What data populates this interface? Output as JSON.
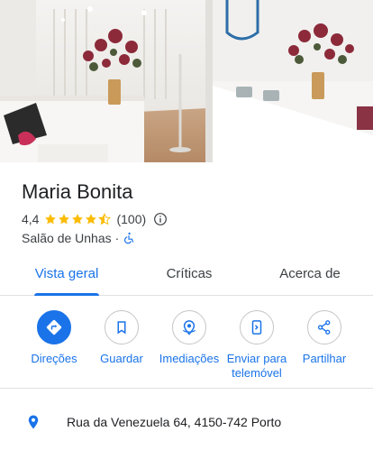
{
  "place": {
    "name": "Maria Bonita",
    "rating": "4,4",
    "stars": 4.4,
    "review_count": "(100)",
    "category": "Salão de Unhas",
    "separator": "·"
  },
  "tabs": [
    {
      "label": "Vista geral",
      "active": true
    },
    {
      "label": "Críticas",
      "active": false
    },
    {
      "label": "Acerca de",
      "active": false
    }
  ],
  "actions": [
    {
      "label": "Direções",
      "icon": "directions-icon"
    },
    {
      "label": "Guardar",
      "icon": "bookmark-icon"
    },
    {
      "label": "Imediações",
      "icon": "nearby-icon"
    },
    {
      "label": "Enviar para telemóvel",
      "icon": "send-to-phone-icon"
    },
    {
      "label": "Partilhar",
      "icon": "share-icon"
    }
  ],
  "address": "Rua da Venezuela 64, 4150-742 Porto",
  "colors": {
    "accent": "#1a73e8",
    "star": "#fbbc04",
    "text": "#202124",
    "secondary_text": "#3c4043"
  }
}
